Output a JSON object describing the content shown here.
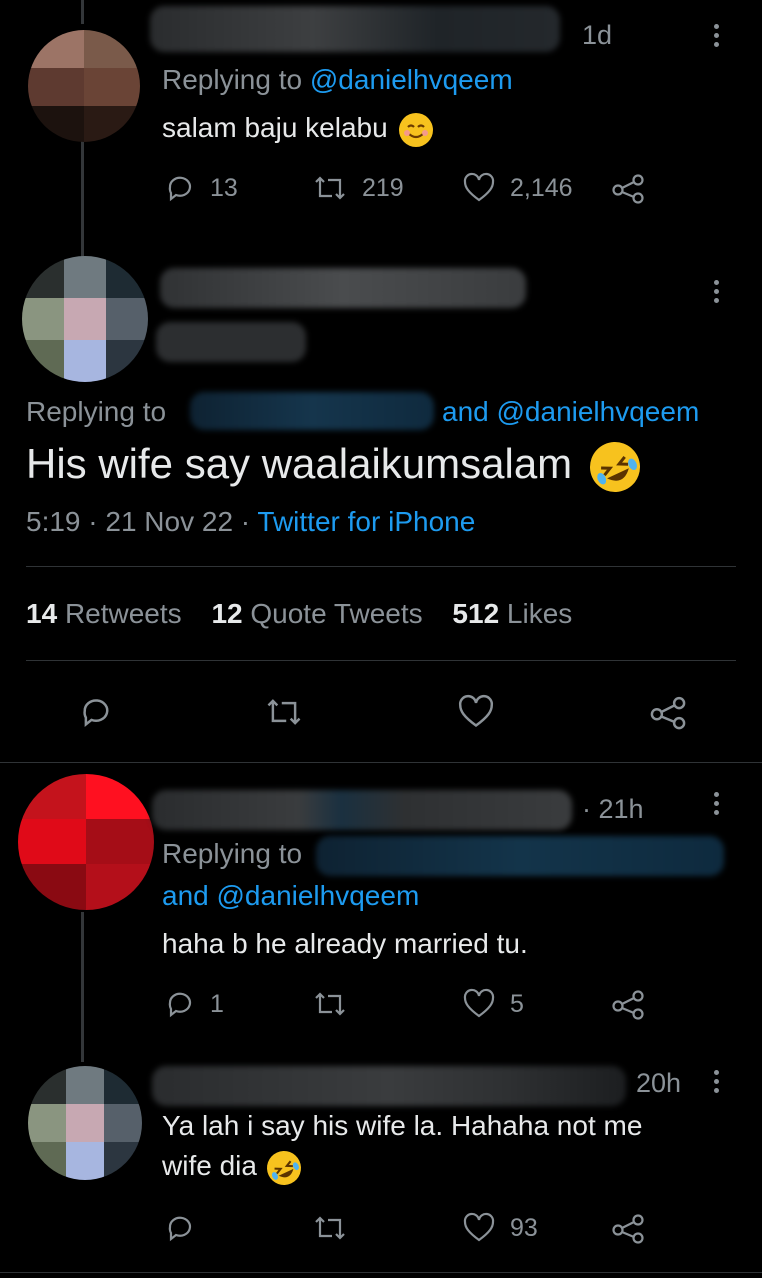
{
  "tweet1": {
    "time": "1d",
    "replying_prefix": "Replying to",
    "replying_handle": "@danielhvqeem",
    "text": "salam baju kelabu",
    "emoji": "smiling-face-emoji",
    "replies": "13",
    "retweets": "219",
    "likes": "2,146"
  },
  "main_tweet": {
    "replying_prefix": "Replying to",
    "replying_and": "and @danielhvqeem",
    "text": "His wife say waalaikumsalam",
    "emoji": "rolling-on-floor-laughing-emoji",
    "timestamp": "5:19 · 21 Nov 22 ·",
    "source": "Twitter for iPhone",
    "retweets_count": "14",
    "retweets_label": "Retweets",
    "quotes_count": "12",
    "quotes_label": "Quote Tweets",
    "likes_count": "512",
    "likes_label": "Likes"
  },
  "tweet3": {
    "time": "· 21h",
    "replying_prefix": "Replying to",
    "replying_and": "and @danielhvqeem",
    "text": "haha b he already married tu.",
    "replies": "1",
    "likes": "5"
  },
  "tweet4": {
    "time": "20h",
    "text_line1": "Ya lah i say his wife la. Hahaha not me",
    "text_line2": "wife dia",
    "emoji": "rolling-on-floor-laughing-emoji",
    "likes": "93"
  },
  "colors": {
    "background": "#000000",
    "text": "#e7e9ea",
    "muted": "#8b9298",
    "link": "#1d9bf0",
    "divider": "#2f3336"
  }
}
